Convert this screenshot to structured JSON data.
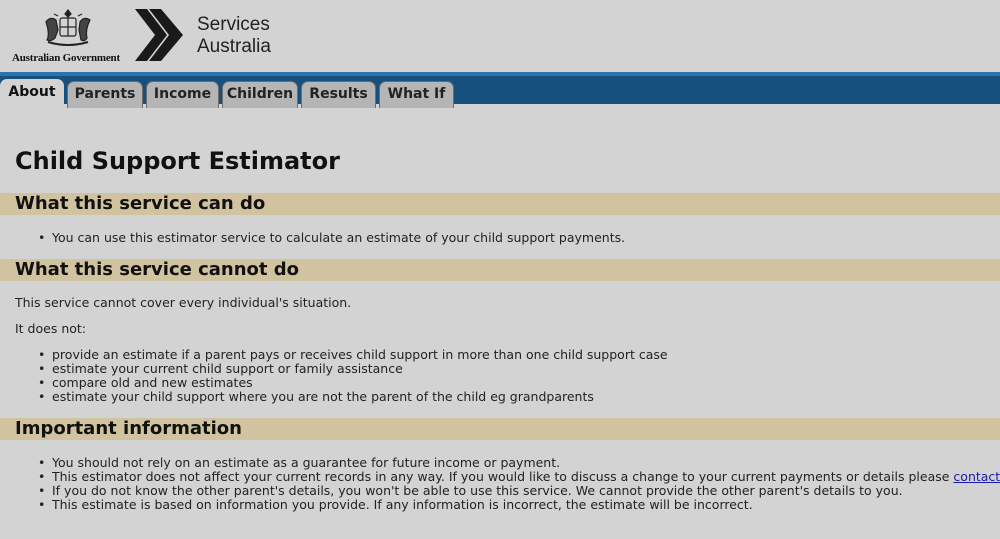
{
  "header": {
    "gov_label": "Australian Government",
    "brand_line1": "Services",
    "brand_line2": "Australia"
  },
  "tabs": [
    {
      "label": "About",
      "active": true
    },
    {
      "label": "Parents"
    },
    {
      "label": "Income"
    },
    {
      "label": "Children"
    },
    {
      "label": "Results"
    },
    {
      "label": "What If"
    }
  ],
  "page": {
    "title": "Child Support Estimator",
    "section1": {
      "heading": "What this service can do",
      "items": [
        "You can use this estimator service to calculate an estimate of your child support payments."
      ]
    },
    "section2": {
      "heading": "What this service cannot do",
      "intro": "This service cannot cover every individual's situation.",
      "subintro": "It does not:",
      "items": [
        "provide an estimate if a parent pays or receives child support in more than one child support case",
        "estimate your current child support or family assistance",
        "compare old and new estimates",
        "estimate your child support where you are not the parent of the child eg grandparents"
      ]
    },
    "section3": {
      "heading": "Important information",
      "item1": "You should not rely on an estimate as a guarantee for future income or payment.",
      "item2_before": "This estimator does not affect your current records in any way. If you would like to discuss a change to your current payments or details please",
      "item2_link": "contact us",
      "item2_after": ".",
      "item3": "If you do not know the other parent's details, you won't be able to use this service. We cannot provide the other parent's details to you.",
      "item4": "This estimate is based on information you provide. If any information is incorrect, the estimate will be incorrect."
    }
  },
  "colors": {
    "nav_bar": "#15507f",
    "section_band": "#d1c3a0",
    "page_bg": "#d3d3d3",
    "link": "#1a1aa6"
  }
}
